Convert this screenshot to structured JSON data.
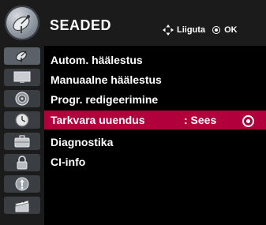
{
  "header": {
    "title": "SEADED",
    "icon": "satellite-dish-icon",
    "nav_hint": "Liiguta",
    "ok_hint": "OK"
  },
  "categories": [
    {
      "name": "satellite-dish-icon",
      "active": true
    },
    {
      "name": "tv-screen-icon",
      "active": false
    },
    {
      "name": "speaker-icon",
      "active": false
    },
    {
      "name": "clock-icon",
      "active": false
    },
    {
      "name": "toolbox-icon",
      "active": false
    },
    {
      "name": "lock-icon",
      "active": false
    },
    {
      "name": "media-icon",
      "active": false
    },
    {
      "name": "clapperboard-icon",
      "active": false
    }
  ],
  "menu": {
    "items": [
      {
        "label": "Autom. häälestus",
        "value": ""
      },
      {
        "label": "Manuaalne häälestus",
        "value": ""
      },
      {
        "label": "Progr. redigeerimine",
        "value": ""
      },
      {
        "label": "Tarkvara uuendus",
        "value": ": Sees"
      },
      {
        "label": "Diagnostika",
        "value": ""
      },
      {
        "label": "CI-info",
        "value": ""
      }
    ],
    "selected_index": 3
  },
  "colors": {
    "selection": "#b2003c",
    "panel": "#000000",
    "frame": "#1b1b1b"
  }
}
